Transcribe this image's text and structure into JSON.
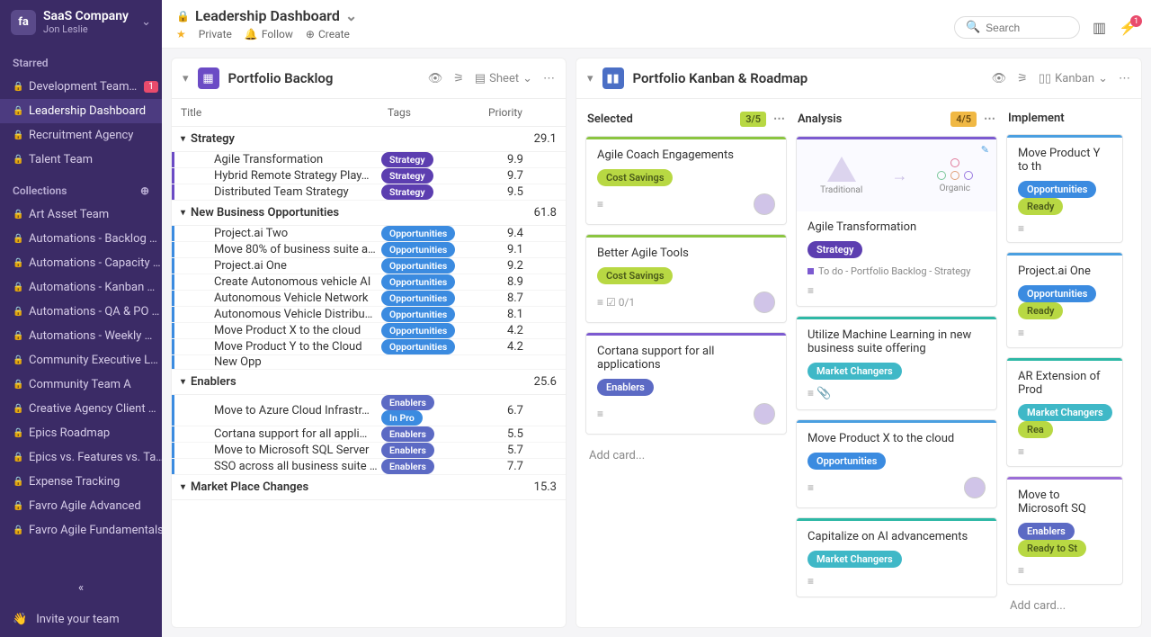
{
  "org": {
    "name": "SaaS Company",
    "user": "Jon Leslie"
  },
  "starred_label": "Starred",
  "collections_label": "Collections",
  "invite_label": "Invite your team",
  "starred": [
    {
      "label": "Development Team…",
      "badge": "1"
    },
    {
      "label": "Leadership Dashboard",
      "active": true
    },
    {
      "label": "Recruitment Agency"
    },
    {
      "label": "Talent Team"
    }
  ],
  "collections": [
    {
      "label": "Art Asset Team"
    },
    {
      "label": "Automations - Backlog …"
    },
    {
      "label": "Automations - Capacity …"
    },
    {
      "label": "Automations - Kanban …"
    },
    {
      "label": "Automations - QA & PO …"
    },
    {
      "label": "Automations - Weekly …"
    },
    {
      "label": "Community Executive L…"
    },
    {
      "label": "Community Team A"
    },
    {
      "label": "Creative Agency Client …"
    },
    {
      "label": "Epics Roadmap"
    },
    {
      "label": "Epics vs. Features vs. Ta…"
    },
    {
      "label": "Expense Tracking"
    },
    {
      "label": "Favro Agile Advanced"
    },
    {
      "label": "Favro Agile Fundamentals"
    }
  ],
  "page": {
    "title": "Leadership Dashboard",
    "private": "Private",
    "follow": "Follow",
    "create": "Create"
  },
  "search_placeholder": "Search",
  "notif_count": "1",
  "backlog": {
    "title": "Portfolio Backlog",
    "view": "Sheet",
    "cols": {
      "title": "Title",
      "tags": "Tags",
      "priority": "Priority"
    },
    "swimlanes": [
      {
        "name": "Strategy",
        "value": "29.1",
        "bar": "purple",
        "rows": [
          {
            "title": "Agile Transformation",
            "tag": "Strategy",
            "tagcls": "strategy",
            "prio": "9.9"
          },
          {
            "title": "Hybrid Remote Strategy Play…",
            "tag": "Strategy",
            "tagcls": "strategy",
            "prio": "9.7"
          },
          {
            "title": "Distributed Team Strategy",
            "tag": "Strategy",
            "tagcls": "strategy",
            "prio": "9.5"
          }
        ]
      },
      {
        "name": "New Business Opportunities",
        "value": "61.8",
        "bar": "blue",
        "rows": [
          {
            "title": "Project.ai Two",
            "tag": "Opportunities",
            "tagcls": "opps",
            "prio": "9.4"
          },
          {
            "title": "Move 80% of business suite a…",
            "tag": "Opportunities",
            "tagcls": "opps",
            "prio": "9.1"
          },
          {
            "title": "Project.ai One",
            "tag": "Opportunities",
            "tagcls": "opps",
            "prio": "9.2"
          },
          {
            "title": "Create Autonomous vehicle AI",
            "tag": "Opportunities",
            "tagcls": "opps",
            "prio": "8.9"
          },
          {
            "title": "Autonomous Vehicle Network",
            "tag": "Opportunities",
            "tagcls": "opps",
            "prio": "8.7"
          },
          {
            "title": "Autonomous Vehicle Distribu…",
            "tag": "Opportunities",
            "tagcls": "opps",
            "prio": "8.1"
          },
          {
            "title": "Move Product X to the cloud",
            "tag": "Opportunities",
            "tagcls": "opps",
            "prio": "4.2"
          },
          {
            "title": "Move Product Y to the Cloud",
            "tag": "Opportunities",
            "tagcls": "opps",
            "prio": "4.2"
          },
          {
            "title": "New Opp",
            "tag": "",
            "tagcls": "",
            "prio": ""
          }
        ]
      },
      {
        "name": "Enablers",
        "value": "25.6",
        "bar": "blue",
        "rows": [
          {
            "title": "Move to Azure Cloud Infrastr…",
            "tag": "Enablers",
            "tagcls": "enablers",
            "tag2": "In Pro",
            "tag2cls": "inpro",
            "prio": "6.7"
          },
          {
            "title": "Cortana support for all appli…",
            "tag": "Enablers",
            "tagcls": "enablers",
            "prio": "5.5"
          },
          {
            "title": "Move to Microsoft SQL Server",
            "tag": "Enablers",
            "tagcls": "enablers",
            "prio": "5.7"
          },
          {
            "title": "SSO across all business suite …",
            "tag": "Enablers",
            "tagcls": "enablers",
            "prio": "7.7"
          }
        ]
      },
      {
        "name": "Market Place Changes",
        "value": "15.3",
        "bar": "teal",
        "rows": []
      }
    ]
  },
  "kanban": {
    "title": "Portfolio Kanban & Roadmap",
    "view": "Kanban",
    "columns": [
      {
        "name": "Selected",
        "count": "3/5",
        "countcls": "",
        "cards": [
          {
            "bar": "green",
            "title": "Agile Coach Engagements",
            "tag": "Cost Savings",
            "tagcls": "cost",
            "avatar": true,
            "desc": true
          },
          {
            "bar": "green",
            "title": "Better Agile Tools",
            "tag": "Cost Savings",
            "tagcls": "cost",
            "avatar": true,
            "desc": true,
            "check": "0/1"
          },
          {
            "bar": "purple",
            "title": "Cortana support for all applications",
            "tag": "Enablers",
            "tagcls": "enablers",
            "avatar": true,
            "desc": true
          }
        ],
        "add": "Add card..."
      },
      {
        "name": "Analysis",
        "count": "4/5",
        "countcls": "warn",
        "cards": [
          {
            "bar": "purple",
            "diagram": true,
            "diag_left": "Traditional",
            "diag_right": "Organic",
            "title": "Agile Transformation",
            "tag": "Strategy",
            "tagcls": "strategy",
            "sub": "To do - Portfolio Backlog - Strategy",
            "desc": true,
            "edit": true
          },
          {
            "bar": "teal",
            "title": "Utilize Machine Learning in new business suite offering",
            "tag": "Market Changers",
            "tagcls": "market",
            "desc": true,
            "attach": true
          },
          {
            "bar": "blue",
            "title": "Move Product X to the cloud",
            "tag": "Opportunities",
            "tagcls": "opps",
            "desc": true,
            "avatar": true
          },
          {
            "bar": "teal",
            "title": "Capitalize on AI advancements",
            "tag": "Market Changers",
            "tagcls": "market",
            "desc": true
          }
        ]
      },
      {
        "name": "Implement",
        "count": "",
        "cards": [
          {
            "bar": "blue",
            "title": "Move Product Y to th",
            "tag": "Opportunities",
            "tagcls": "opps",
            "tag2": "Ready",
            "tag2cls": "cost",
            "desc": true
          },
          {
            "bar": "blue",
            "title": "Project.ai One",
            "tag": "Opportunities",
            "tagcls": "opps",
            "tag2": "Ready",
            "tag2cls": "cost",
            "desc": true
          },
          {
            "bar": "teal",
            "title": "AR Extension of Prod",
            "tag": "Market Changers",
            "tagcls": "market",
            "tag2": "Rea",
            "tag2cls": "cost",
            "desc": true
          },
          {
            "bar": "violet",
            "title": "Move to Microsoft SQ",
            "tag": "Enablers",
            "tagcls": "enablers",
            "tag2": "Ready to St",
            "tag2cls": "cost",
            "desc": true
          }
        ],
        "add": "Add card..."
      }
    ]
  }
}
